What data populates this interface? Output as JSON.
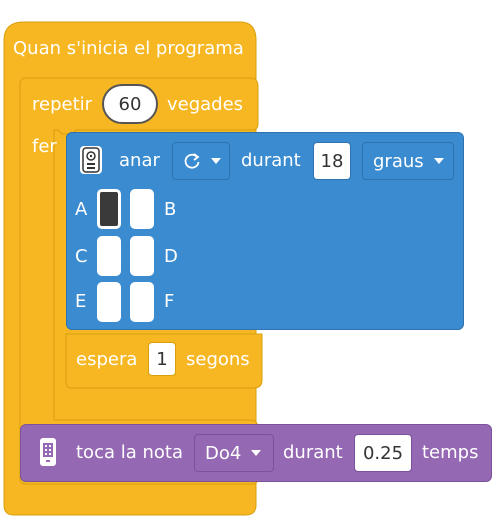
{
  "colors": {
    "event": "#F6B722",
    "event_border": "#D99F0F",
    "control": "#F6B722",
    "motion": "#3A8BD0",
    "motion_border": "#2E73B0",
    "sound": "#9468B3",
    "sound_border": "#7B529B",
    "cell_on": "#3A3A3A"
  },
  "hat_block": {
    "label": "Quan s'inicia el programa"
  },
  "repeat_block": {
    "label_before": "repetir",
    "times": "60",
    "label_after": "vegades",
    "body_label": "fer"
  },
  "move_block": {
    "icon": "remote-control-icon",
    "label": "anar",
    "direction_icon": "rotate-clockwise-icon",
    "label_for": "durant",
    "amount": "18",
    "unit": "graus",
    "rows": [
      {
        "left": "A",
        "right": "B",
        "left_on": true,
        "right_on": false
      },
      {
        "left": "C",
        "right": "D",
        "left_on": false,
        "right_on": false
      },
      {
        "left": "E",
        "right": "F",
        "left_on": false,
        "right_on": false
      }
    ]
  },
  "wait_block": {
    "label": "espera",
    "value": "1",
    "unit": "segons"
  },
  "note_block": {
    "icon": "device-icon",
    "label": "toca la nota",
    "note": "Do4",
    "label_for": "durant",
    "beats": "0.25",
    "unit": "temps"
  }
}
